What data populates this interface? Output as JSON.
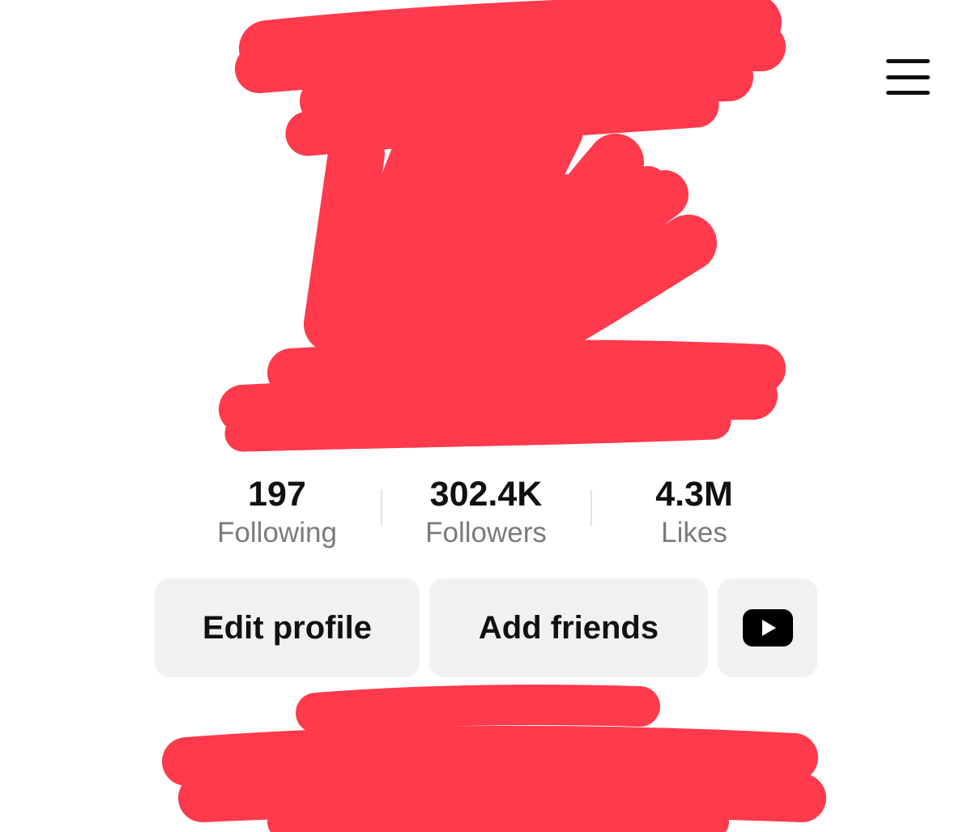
{
  "header": {
    "menu_icon": "hamburger-menu-icon"
  },
  "stats": [
    {
      "value": "197",
      "label": "Following"
    },
    {
      "value": "302.4K",
      "label": "Followers"
    },
    {
      "value": "4.3M",
      "label": "Likes"
    }
  ],
  "actions": {
    "edit_profile_label": "Edit profile",
    "add_friends_label": "Add friends",
    "youtube_icon": "youtube-icon"
  },
  "colors": {
    "redaction": "#ff3447",
    "button_bg": "#f1f1f3",
    "secondary_text": "#7b7b7f"
  }
}
